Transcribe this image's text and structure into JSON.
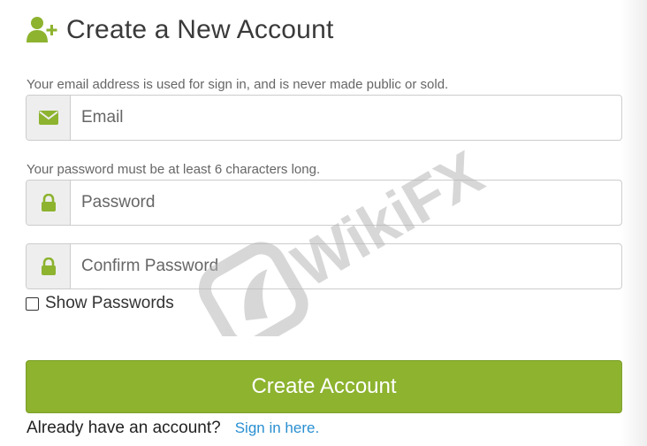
{
  "header": {
    "title": "Create a New Account",
    "icon": "add-user-icon"
  },
  "email": {
    "hint": "Your email address is used for sign in, and is never made public or sold.",
    "placeholder": "Email",
    "value": "",
    "icon": "envelope-icon"
  },
  "password": {
    "hint": "Your password must be at least 6 characters long.",
    "placeholder": "Password",
    "value": "",
    "icon": "lock-icon"
  },
  "confirm_password": {
    "placeholder": "Confirm Password",
    "value": "",
    "icon": "lock-icon"
  },
  "show_passwords": {
    "label": "Show Passwords",
    "checked": false
  },
  "create_button": {
    "label": "Create Account"
  },
  "footer": {
    "text": "Already have an account?",
    "link": "Sign in here."
  },
  "watermark": {
    "text": "WikiFX"
  },
  "colors": {
    "accent": "#8db32f",
    "link": "#2a8fd1",
    "addon_bg": "#eeeeee"
  }
}
